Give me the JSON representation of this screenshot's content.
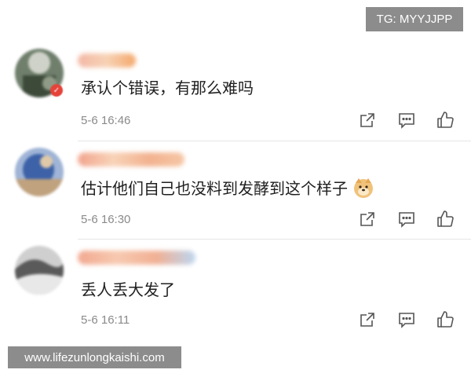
{
  "watermark_tg": "TG: MYYJJPP",
  "watermark_site": "www.lifezunlongkaishi.com",
  "comments": [
    {
      "text": "承认个错误，有那么难吗",
      "time": "5-6 16:46",
      "emoji": ""
    },
    {
      "text": "估计他们自己也没料到发酵到这个样子",
      "time": "5-6 16:30",
      "emoji": "doge"
    },
    {
      "text": "丢人丢大发了",
      "time": "5-6 16:11",
      "emoji": ""
    }
  ],
  "icons": {
    "share": "share-icon",
    "comment": "comment-icon",
    "like": "thumbs-up-icon"
  },
  "colors": {
    "text": "#1f1f1f",
    "timestamp": "#8a8a8a",
    "icon": "#555555",
    "watermark_bg": "#8c8c8c"
  }
}
